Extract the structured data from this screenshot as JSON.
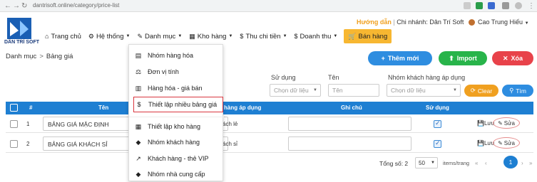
{
  "browser": {
    "url": "dantrisoft.online/category/price-list"
  },
  "brand": {
    "logo_text": "DÂN TRÍ SOFT"
  },
  "topbar": {
    "help": "Hướng dẫn",
    "branch": "Chi nhánh: Dân Trí Soft",
    "user": "Cao Trung Hiếu"
  },
  "nav": {
    "home": "Trang chủ",
    "system": "Hệ thống",
    "category": "Danh mục",
    "warehouse": "Kho hàng",
    "income": "Thu chi tiền",
    "revenue": "Doanh thu",
    "sale": "Bán hàng"
  },
  "breadcrumb": {
    "root": "Danh mục",
    "sep": ">",
    "current": "Bảng giá"
  },
  "actions": {
    "add": "Thêm mới",
    "import": "Import",
    "delete": "Xóa"
  },
  "filters": {
    "usage_label": "Sử dụng",
    "usage_placeholder": "Chọn dữ liệu",
    "name_label": "Tên",
    "name_placeholder": "Tên",
    "group_label": "Nhóm khách hàng áp dụng",
    "group_placeholder": "Chọn dữ liệu",
    "clear": "Clear",
    "search": "Tìm"
  },
  "table": {
    "headers": {
      "num": "#",
      "name": "Tên",
      "group": "hàng áp dụng",
      "note": "Ghi chú",
      "usage": "Sử dụng"
    },
    "rows": [
      {
        "num": "1",
        "name": "BẢNG GIÁ MẶC ĐỊNH",
        "group": "ách lẻ",
        "save": "Lưu",
        "edit": "Sửa"
      },
      {
        "num": "2",
        "name": "BẢNG GIÁ KHÁCH SỈ",
        "group": "ách sỉ",
        "save": "Lưu",
        "edit": "Sửa"
      }
    ]
  },
  "pagination": {
    "total": "Tổng số: 2",
    "page_size": "50",
    "per_page": "items/trang",
    "current": "1"
  },
  "menu": {
    "items": [
      "Nhóm hàng hóa",
      "Đơn vị tính",
      "Hàng hóa - giá bán",
      "Thiết lập nhiều bảng giá",
      "Thiết lập kho hàng",
      "Nhóm khách hàng",
      "Khách hàng - thẻ VIP",
      "Nhóm nhà cung cấp"
    ]
  },
  "colors": {
    "primary": "#1e7fd2",
    "success": "#28b44a",
    "danger": "#e8424a",
    "warning": "#f0a020"
  }
}
